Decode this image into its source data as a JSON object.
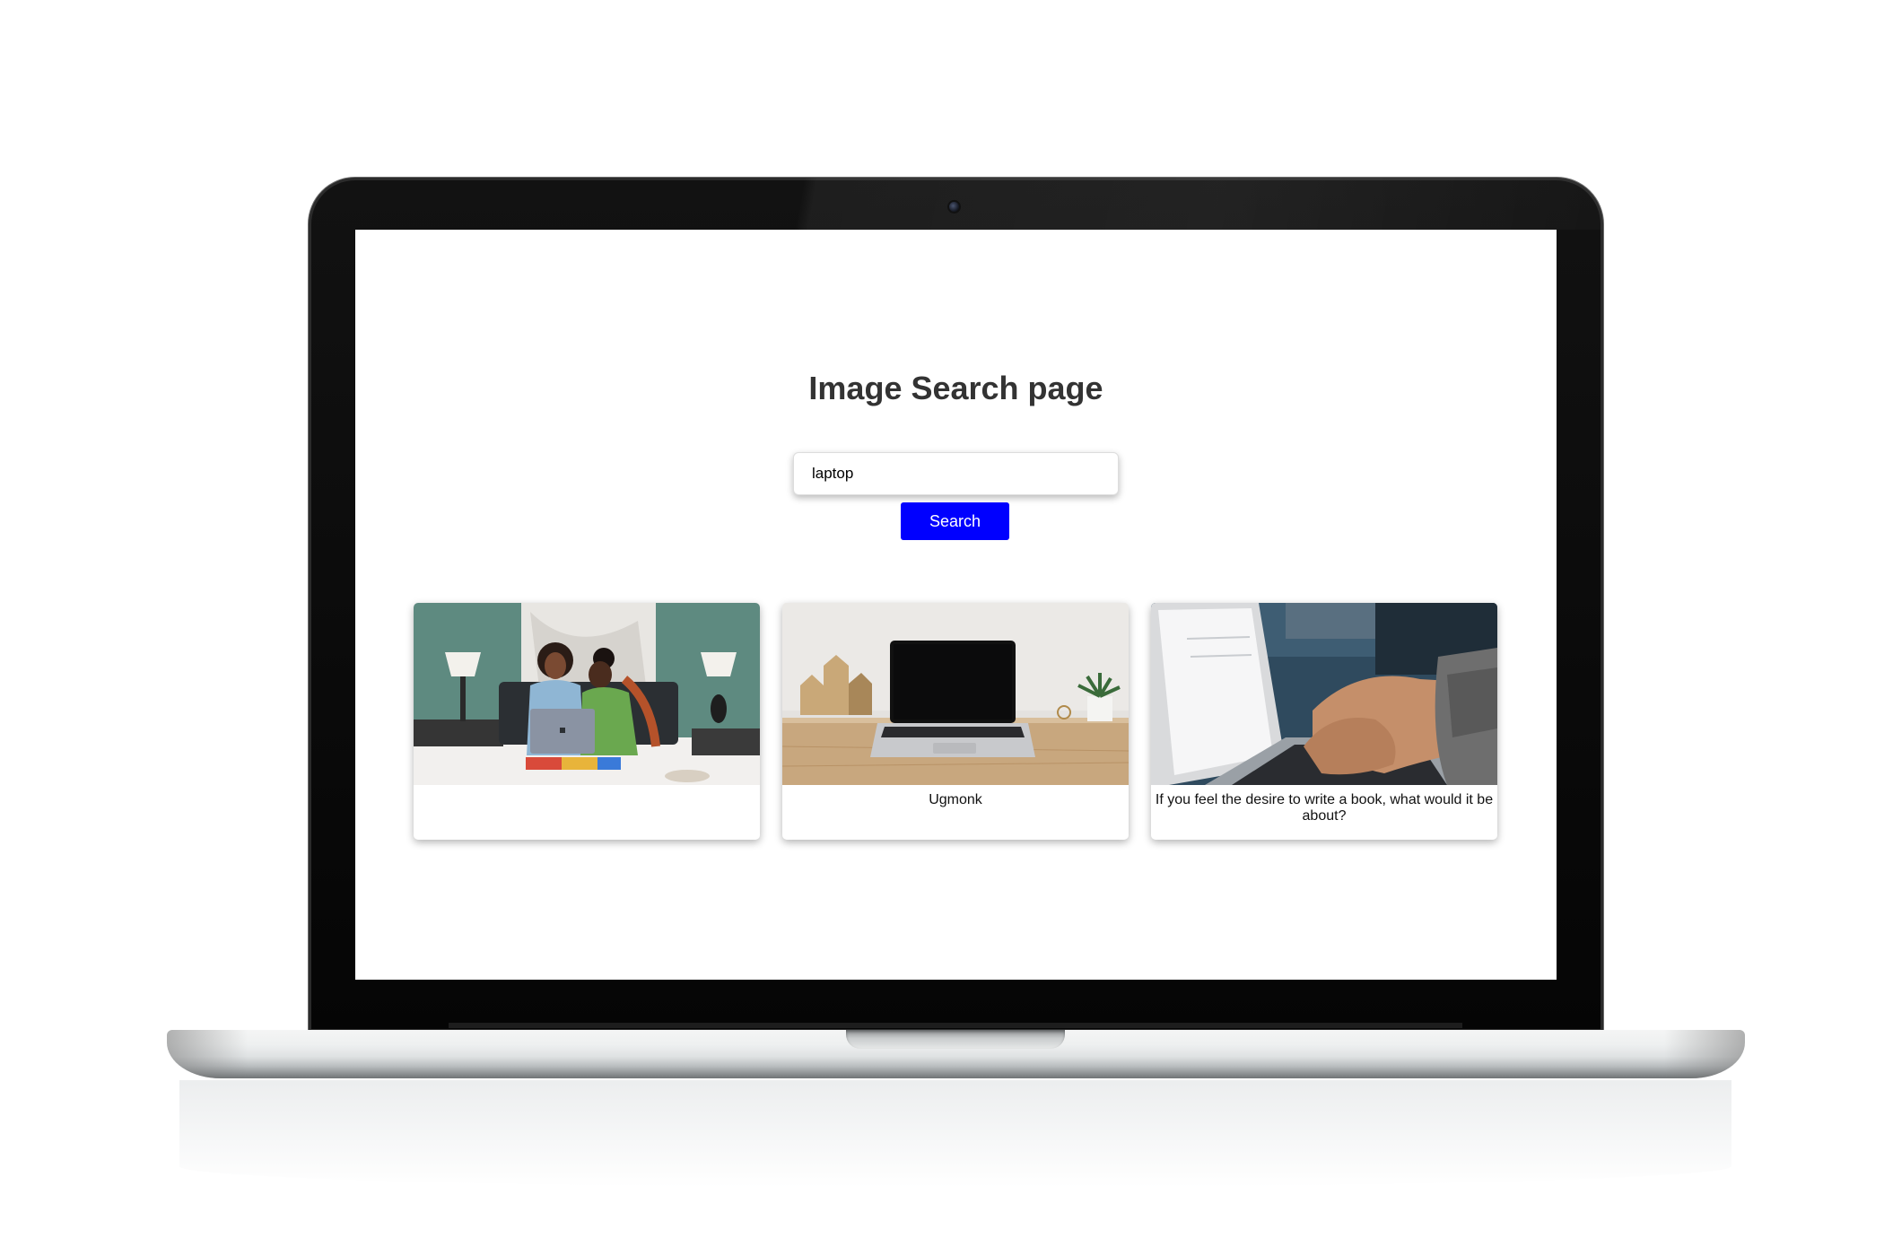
{
  "page": {
    "title": "Image Search page"
  },
  "search": {
    "value": "laptop",
    "button_label": "Search"
  },
  "results": [
    {
      "caption": "",
      "image": "two-women-laptop-photo"
    },
    {
      "caption": "Ugmonk",
      "image": "laptop-on-desk-photo"
    },
    {
      "caption": "If you feel the desire to write a book, what would it be about?",
      "image": "hands-typing-laptop-photo"
    }
  ],
  "colors": {
    "button_bg": "#0000ff",
    "button_text": "#ffffff",
    "title": "#333333"
  }
}
